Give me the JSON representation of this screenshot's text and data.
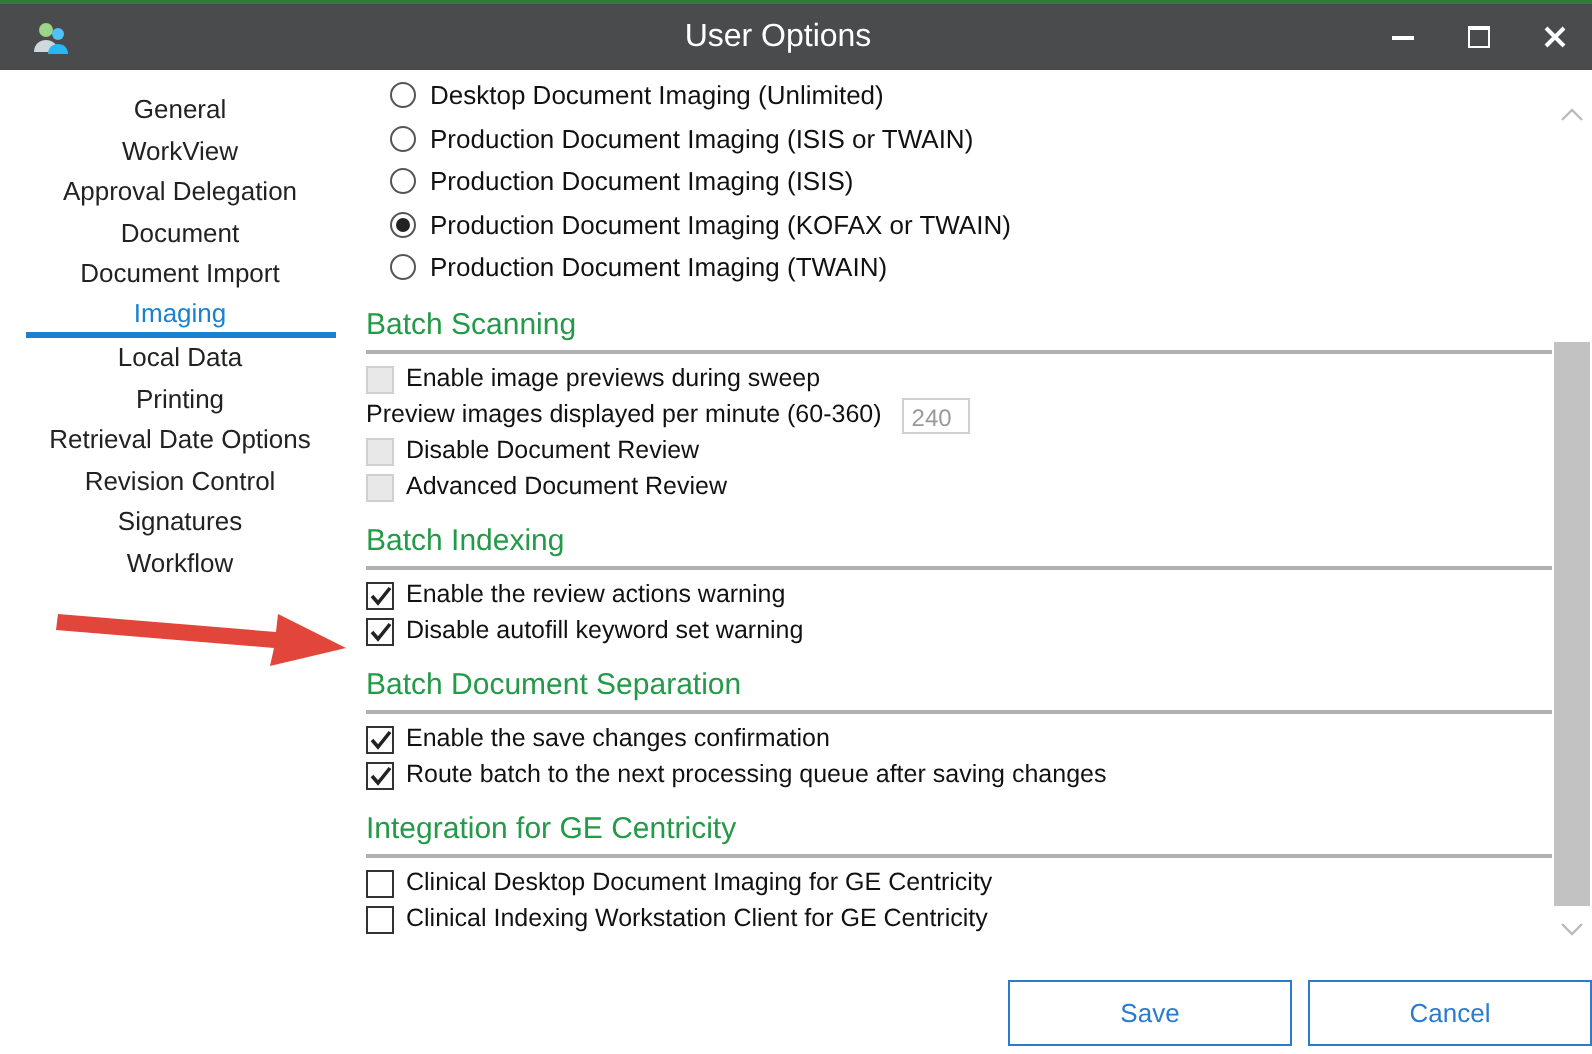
{
  "window": {
    "title": "User Options"
  },
  "sidebar": {
    "items": [
      {
        "label": "General",
        "selected": false
      },
      {
        "label": "WorkView",
        "selected": false
      },
      {
        "label": "Approval Delegation",
        "selected": false
      },
      {
        "label": "Document",
        "selected": false
      },
      {
        "label": "Document Import",
        "selected": false
      },
      {
        "label": "Imaging",
        "selected": true
      },
      {
        "label": "Local Data",
        "selected": false
      },
      {
        "label": "Printing",
        "selected": false
      },
      {
        "label": "Retrieval Date Options",
        "selected": false
      },
      {
        "label": "Revision Control",
        "selected": false
      },
      {
        "label": "Signatures",
        "selected": false
      },
      {
        "label": "Workflow",
        "selected": false
      }
    ]
  },
  "radios": [
    {
      "label": "Desktop Document Imaging (Unlimited)",
      "selected": false
    },
    {
      "label": "Production Document Imaging (ISIS or TWAIN)",
      "selected": false
    },
    {
      "label": "Production Document Imaging (ISIS)",
      "selected": false
    },
    {
      "label": "Production Document Imaging (KOFAX or TWAIN)",
      "selected": true
    },
    {
      "label": "Production Document Imaging (TWAIN)",
      "selected": false
    }
  ],
  "sections": [
    {
      "title": "Batch Scanning",
      "items": [
        {
          "kind": "checkbox",
          "label": "Enable image previews during sweep",
          "checked": false,
          "disabled": true
        },
        {
          "kind": "number",
          "label": "Preview images displayed per minute (60-360)",
          "value": "240",
          "disabled": true
        },
        {
          "kind": "checkbox",
          "label": "Disable Document Review",
          "checked": false,
          "disabled": true
        },
        {
          "kind": "checkbox",
          "label": "Advanced Document Review",
          "checked": false,
          "disabled": true
        }
      ]
    },
    {
      "title": "Batch Indexing",
      "items": [
        {
          "kind": "checkbox",
          "label": "Enable the review actions warning",
          "checked": true,
          "disabled": false
        },
        {
          "kind": "checkbox",
          "label": "Disable autofill keyword set warning",
          "checked": true,
          "disabled": false
        }
      ]
    },
    {
      "title": "Batch Document Separation",
      "items": [
        {
          "kind": "checkbox",
          "label": "Enable the save changes confirmation",
          "checked": true,
          "disabled": false
        },
        {
          "kind": "checkbox",
          "label": "Route batch to the next processing queue after saving changes",
          "checked": true,
          "disabled": false
        }
      ]
    },
    {
      "title": "Integration for GE Centricity",
      "items": [
        {
          "kind": "checkbox",
          "label": "Clinical Desktop Document Imaging for GE Centricity",
          "checked": false,
          "disabled": false
        },
        {
          "kind": "checkbox",
          "label": "Clinical Indexing Workstation Client for GE Centricity",
          "checked": false,
          "disabled": false
        }
      ]
    }
  ],
  "buttons": [
    {
      "label": "Save"
    },
    {
      "label": "Cancel"
    }
  ]
}
